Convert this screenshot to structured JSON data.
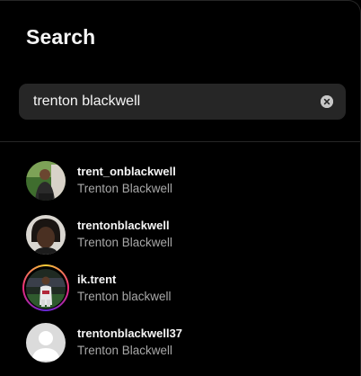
{
  "header": {
    "title": "Search"
  },
  "search": {
    "value": "trenton blackwell"
  },
  "results": [
    {
      "username": "trent_onblackwell",
      "fullname": "Trenton Blackwell",
      "avatar": "person-photo-green-bg",
      "story_ring": false
    },
    {
      "username": "trentonblackwell",
      "fullname": "Trenton Blackwell",
      "avatar": "person-photo-dreads",
      "story_ring": false
    },
    {
      "username": "ik.trent",
      "fullname": "Trenton blackwell",
      "avatar": "football-player-photo",
      "story_ring": true
    },
    {
      "username": "trentonblackwell37",
      "fullname": "Trenton Blackwell",
      "avatar": "default-avatar",
      "story_ring": false
    }
  ],
  "colors": {
    "background": "#000000",
    "search_field": "#262626",
    "primary_text": "#f5f5f5",
    "secondary_text": "#a8a8a8",
    "divider": "#262626",
    "story_ring": [
      "#f9ce34",
      "#ee2a7b",
      "#6228d7"
    ]
  }
}
